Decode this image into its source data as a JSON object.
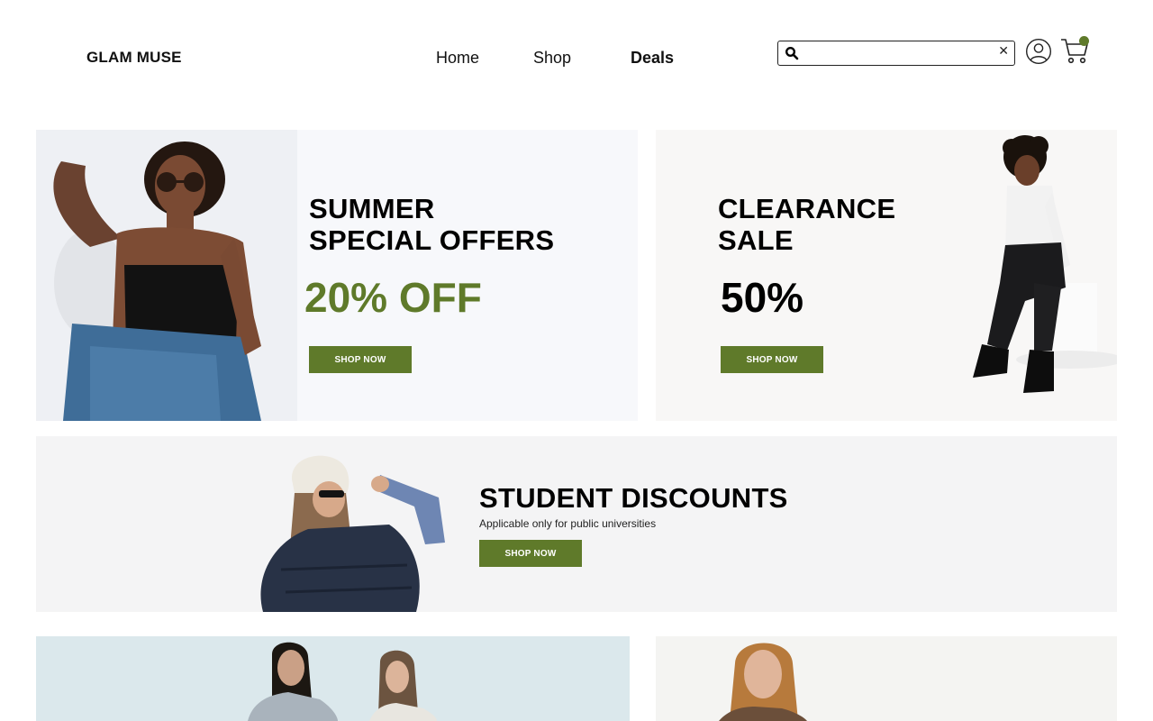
{
  "brand": {
    "name": "GLAM MUSE",
    "accent": "#6b7b2f"
  },
  "nav": {
    "home": "Home",
    "shop": "Shop",
    "deals": "Deals"
  },
  "search": {
    "value": "",
    "placeholder": ""
  },
  "banners": {
    "summer": {
      "title_line1": "SUMMER",
      "title_line2": "SPECIAL OFFERS",
      "discount": "20% OFF",
      "cta": "SHOP NOW"
    },
    "clearance": {
      "title_line1": "CLEARANCE",
      "title_line2": "SALE",
      "discount": "50%",
      "cta": "SHOP NOW"
    },
    "student": {
      "title": "STUDENT DISCOUNTS",
      "subtitle": "Applicable only for public universities",
      "cta": "SHOP NOW"
    }
  },
  "icons": {
    "search": "search-icon",
    "clear": "close-icon",
    "account": "user-icon",
    "cart": "cart-icon"
  }
}
